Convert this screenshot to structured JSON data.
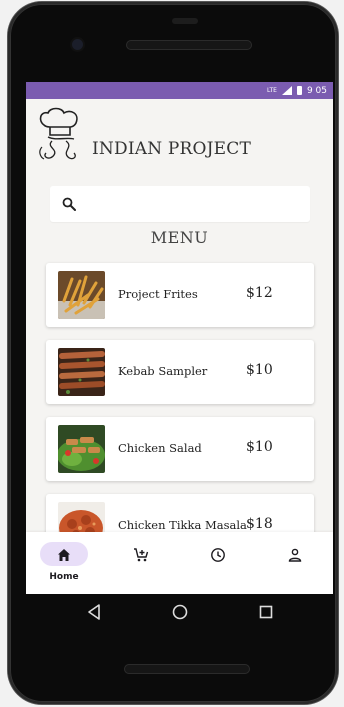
{
  "status_bar": {
    "time": "9 05",
    "signal_badge": "LTE"
  },
  "app": {
    "title": "INDIAN PROJECT"
  },
  "search": {
    "placeholder": ""
  },
  "menu": {
    "heading": "MENU",
    "items": [
      {
        "name": "Project Frites",
        "price": "$12",
        "image": "fries-image"
      },
      {
        "name": "Kebab Sampler",
        "price": "$10",
        "image": "kebab-image"
      },
      {
        "name": "Chicken Salad",
        "price": "$10",
        "image": "salad-image"
      },
      {
        "name": "Chicken Tikka Masala",
        "price": "$18",
        "image": "tikka-image"
      }
    ]
  },
  "bottom_nav": [
    {
      "label": "Home",
      "icon": "home-icon",
      "active": true
    },
    {
      "label": "",
      "icon": "cart-add-icon",
      "active": false
    },
    {
      "label": "",
      "icon": "clock-icon",
      "active": false
    },
    {
      "label": "",
      "icon": "person-icon",
      "active": false
    }
  ],
  "system_nav": [
    "back-icon",
    "home-circle-icon",
    "recents-icon"
  ],
  "colors": {
    "status_bar": "#7b5cb0",
    "active_pill": "#e8def8",
    "screen_bg": "#f5f4f2"
  }
}
